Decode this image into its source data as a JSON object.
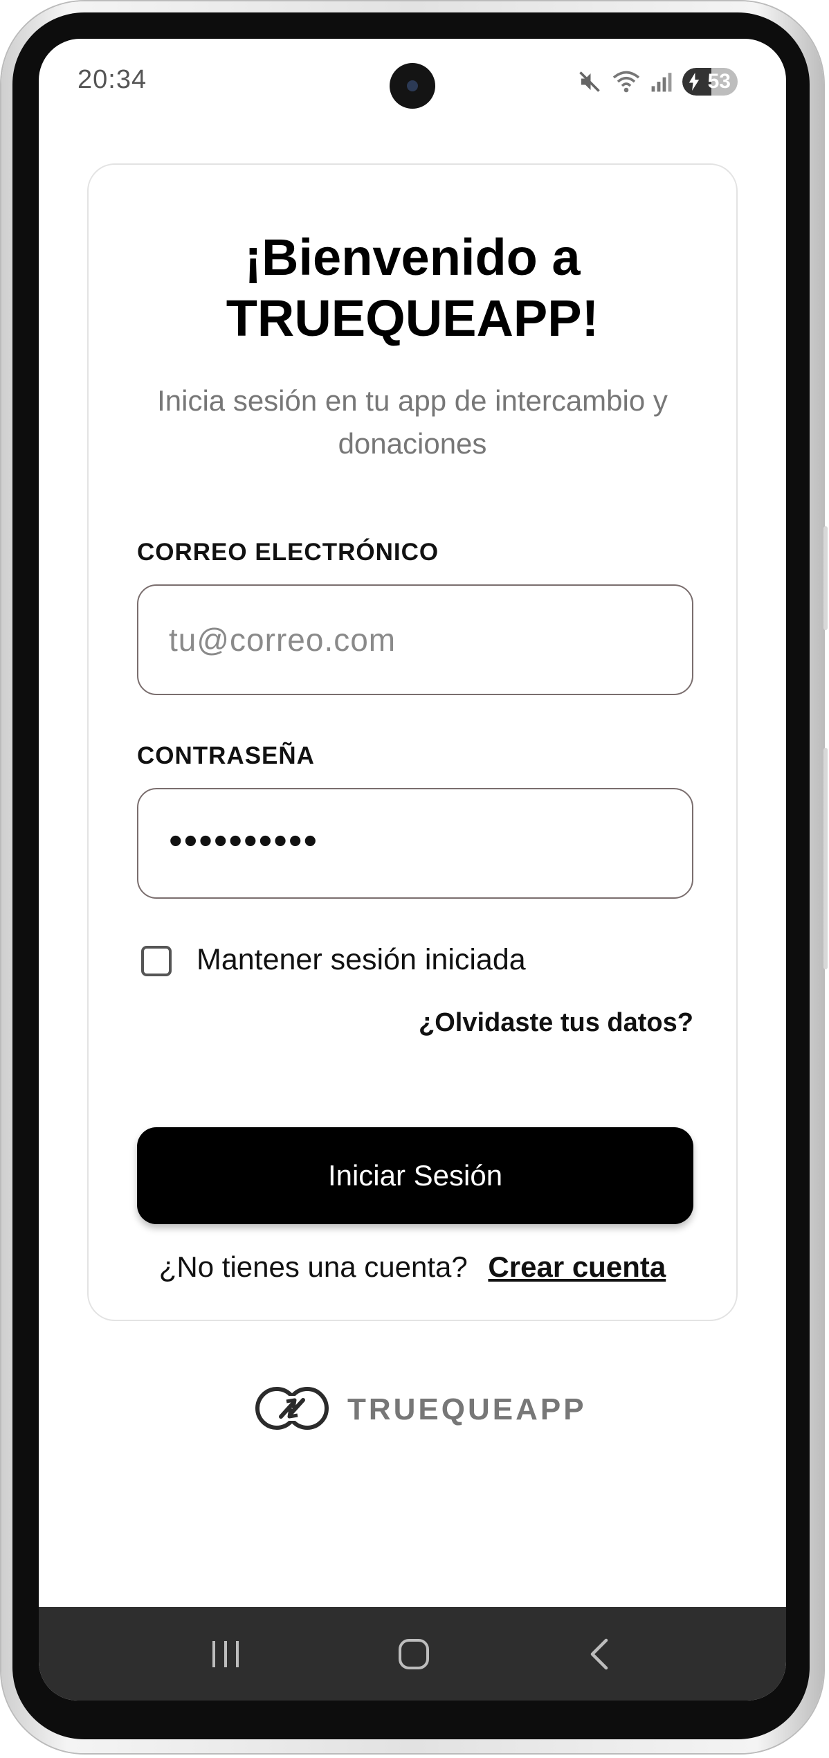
{
  "status_bar": {
    "time": "20:34",
    "battery_percent": "53",
    "icons": [
      "mute-icon",
      "wifi-icon",
      "signal-icon",
      "battery-icon"
    ]
  },
  "login": {
    "title": "¡Bienvenido a TRUEQUEAPP!",
    "subtitle": "Inicia sesión en tu app de intercambio y donaciones",
    "email_label": "CORREO ELECTRÓNICO",
    "email_placeholder": "tu@correo.com",
    "email_value": "",
    "password_label": "CONTRASEÑA",
    "password_value": "••••••••••",
    "remember_label": "Mantener sesión iniciada",
    "remember_checked": false,
    "forgot_link": "¿Olvidaste tus datos?",
    "submit_label": "Iniciar Sesión",
    "no_account_text": "¿No tienes una cuenta?",
    "create_account_link": "Crear cuenta"
  },
  "brand": {
    "name": "TRUEQUEAPP",
    "logo_icon": "exchange-loop-icon"
  },
  "nav_bar": {
    "buttons": [
      "recents-icon",
      "home-icon",
      "back-icon"
    ]
  },
  "colors": {
    "primary_button": "#000000",
    "muted_text": "#777777",
    "input_border": "#7a6e6e",
    "card_border": "#e3e3e3",
    "nav_bar": "#2e2e2e"
  }
}
